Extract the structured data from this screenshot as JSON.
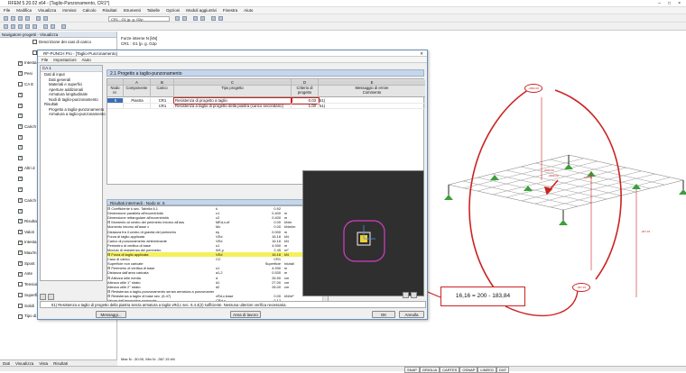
{
  "app": {
    "title": "RFEM 5.20.02 x64 - [Taglio-Punzonamento, CR1*]",
    "menu": [
      "File",
      "Modifica",
      "Visualizza",
      "Immissi",
      "Calcolo",
      "Risultati",
      "Strumenti",
      "Tabelle",
      "Opzioni",
      "Moduli aggiuntivi",
      "Finestra",
      "Aiuto"
    ],
    "window_controls": [
      "–",
      "□",
      "×"
    ],
    "load_combo": "CR1 - G1 |p. g. G2p"
  },
  "navigator": {
    "header": "Navigatore progetti - Visualizza",
    "rows": [
      {
        "label": "Descrizione dei casi di carico",
        "checked": false
      },
      {
        "label": "M",
        "checked": false
      },
      {
        "label": "Intesta",
        "checked": true
      },
      {
        "label": "Pesi",
        "checked": true
      },
      {
        "label": "CA E",
        "checked": false
      },
      {
        "label": "",
        "checked": true
      },
      {
        "label": "",
        "checked": true
      },
      {
        "label": "",
        "checked": true
      },
      {
        "label": "Carich",
        "checked": true
      },
      {
        "label": "",
        "checked": true
      },
      {
        "label": "",
        "checked": true
      },
      {
        "label": "",
        "checked": true
      },
      {
        "label": "Altri d",
        "checked": true
      },
      {
        "label": "",
        "checked": true
      },
      {
        "label": "",
        "checked": true
      },
      {
        "label": "Carich",
        "checked": true
      },
      {
        "label": "",
        "checked": true
      },
      {
        "label": "Risultati",
        "checked": true
      },
      {
        "label": "Valori",
        "checked": true
      },
      {
        "label": "Intesta",
        "checked": true
      },
      {
        "label": "Max/m",
        "checked": true
      },
      {
        "label": "Spost",
        "checked": true
      },
      {
        "label": "Aste",
        "checked": true
      },
      {
        "label": "Tensioni",
        "checked": false
      },
      {
        "label": "Superfici",
        "checked": false
      },
      {
        "label": "Solidi",
        "checked": false
      },
      {
        "label": "Tipo di visualizzazione",
        "checked": false
      }
    ],
    "tabs": [
      "Dati",
      "Visualizza",
      "Vista",
      "Risultati"
    ]
  },
  "model": {
    "header_line1": "Forze interne N [kN]",
    "header_line2": "CR1 : G1 |p. g. G2p",
    "footer": "Max N: -30.00, Min N: -367.15 kN",
    "node_labels": [
      "-2990.00",
      "-2990.00",
      "-183.84",
      "-367.15",
      "-367.15",
      "-183.84"
    ]
  },
  "status": {
    "cells": [
      "SNAP",
      "GRIGLIA",
      "CARTES",
      "OSNAP",
      "LINEEG",
      "DXF"
    ]
  },
  "dialog": {
    "title": "RF-PUNCH Pro - [Taglio-Punzonamento]",
    "menu": [
      "File",
      "Impostazioni",
      "Aiuto"
    ],
    "tree_header": "CA 1",
    "tree": [
      {
        "label": "Dati di input",
        "level": 1
      },
      {
        "label": "Dati generali",
        "level": 2
      },
      {
        "label": "Materiali e superfici",
        "level": 2
      },
      {
        "label": "Aperture addizionali",
        "level": 2
      },
      {
        "label": "Armatura longitudinale",
        "level": 2
      },
      {
        "label": "Nodi di taglio-punzonamento",
        "level": 2
      },
      {
        "label": "Risultati",
        "level": 1
      },
      {
        "label": "Progetto a taglio-punzonamento",
        "level": 2
      },
      {
        "label": "Armatura a taglio-punzonamento",
        "level": 2
      }
    ],
    "section_title": "2.1 Progetto a taglio-punzonamento",
    "columns": {
      "a": "A",
      "b": "B",
      "c": "C",
      "d": "D",
      "e": "E",
      "node": "Nodo\nnr.",
      "component": "Componente",
      "load": "Carico",
      "design_type": "Tipo progetto",
      "criterion": "Criterio di\nprogetto",
      "error": "Messaggio di errore\nCommento"
    },
    "rows": [
      {
        "node": "5",
        "component": "Piastra",
        "load": "CR1",
        "type": "Resistenza di progetto a taglio",
        "value": "0.03",
        "note": "51)"
      },
      {
        "node": "",
        "component": "",
        "load": "CR1",
        "type": "Resistenza a taglio di progetto della piastra (carico secondario)",
        "value": "1.00",
        "note": "51)"
      }
    ],
    "intermediate_header": "Risultati intermedi - Nodo nr. 5",
    "intermediate": [
      {
        "d": "⊟ Coefficiente k sec. Tabella 6.1",
        "s": "k",
        "v": "0.92",
        "u": "",
        "c": ""
      },
      {
        "d": "    Dimensione parallela all'eccentricità",
        "s": "c1",
        "v": "0.400",
        "u": "m",
        "c": ""
      },
      {
        "d": "    Dimensione rettangolare all'eccentricità",
        "s": "c2",
        "v": "0.400",
        "u": "m",
        "c": ""
      },
      {
        "d": "⊟ Momento al centro del perimetro intorno all'ass",
        "s": "MEd,x,ef",
        "v": "0.00",
        "u": "kNm",
        "c": ""
      },
      {
        "d": "    Momento intorno all'asse x",
        "s": "Mx",
        "v": "0.00",
        "u": "kNm/m",
        "c": ""
      },
      {
        "d": "    Distanza fra il centro di gravità del perimetro",
        "s": "ey",
        "v": "0.000",
        "u": "m",
        "c": ""
      },
      {
        "d": "    Forza di taglio applicata",
        "s": "VEd",
        "v": "16.16",
        "u": "kN",
        "c": ""
      },
      {
        "d": "  Carico di punzonamento determinante",
        "s": "VEd",
        "v": "16.16",
        "u": "kN",
        "c": ""
      },
      {
        "d": "  Perimetro di verifica di base",
        "s": "u1",
        "v": "4.930",
        "u": "m",
        "c": ""
      },
      {
        "d": "  Modulo di resistenza del perimetro",
        "s": "W1,y",
        "v": "2.45",
        "u": "m²",
        "c": ""
      },
      {
        "d": "⊟ Forza di taglio applicata",
        "s": "VEd",
        "v": "16.16",
        "u": "kN",
        "c": "",
        "hl": true
      },
      {
        "d": "  Caso di carico",
        "s": "CC",
        "v": "CR1",
        "u": "",
        "c": ""
      },
      {
        "d": "  Superficie non caricate",
        "s": "",
        "v": "Superficie",
        "u": "Iniziali",
        "c": ""
      },
      {
        "d": "⊟ Perimetro di verifica di base",
        "s": "u1",
        "v": "4.930",
        "u": "m",
        "c": ""
      },
      {
        "d": "  Distanza dall'area caricata",
        "s": "a1,2",
        "v": "0.530",
        "u": "m",
        "c": ""
      },
      {
        "d": "⊟ Altezza utile media",
        "s": "d",
        "v": "26.50",
        "u": "cm",
        "c": ""
      },
      {
        "d": "  Altezza utile 1° strato",
        "s": "d1",
        "v": "27.00",
        "u": "cm",
        "c": ""
      },
      {
        "d": "  Altezza utile 2° strato",
        "s": "d2",
        "v": "26.00",
        "u": "cm",
        "c": ""
      },
      {
        "d": "⊟ Resistenza a taglio-punzonamento senza armatura a punzonamento",
        "s": "",
        "v": "",
        "u": "",
        "c": ""
      },
      {
        "d": "  ⊟ Resistenza a taglio di base sec. (6.47)",
        "s": "vRd,c,base",
        "v": "0.00",
        "u": "kN/m²",
        "c": ""
      },
      {
        "d": "    Valore dell'appendice nazionale",
        "s": "CRd,c",
        "v": "0.12",
        "u": "",
        "c": ""
      },
      {
        "d": "    Coefficiente (influenzato dallo spessore)",
        "s": "k",
        "v": "1.87",
        "u": "",
        "c": ""
      }
    ],
    "message": "51) Resistenza a taglio di progetto della piastra senza armatura a taglio vRd,c sec. 6.4.4(2) sufficiente. Nessuna ulteriore verifica necessaria.",
    "buttons": {
      "messages": "Messaggi...",
      "area": "Area di lavoro",
      "ok": "OK",
      "cancel": "Annulla"
    }
  },
  "callout": {
    "text": "16,16 = 200 - 183,84"
  }
}
